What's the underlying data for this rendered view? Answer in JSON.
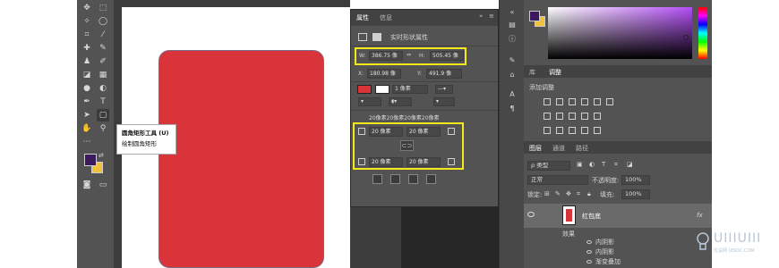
{
  "tooltip": {
    "title": "圆角矩形工具 (U)",
    "desc": "绘制圆角矩形"
  },
  "properties": {
    "tabs": [
      "属性",
      "信息"
    ],
    "header_label": "实时形状属性",
    "w_label": "W:",
    "w_value": "386.75 像",
    "h_label": "H:",
    "h_value": "505.45 像",
    "x_label": "X:",
    "x_value": "180.98 像",
    "y_label": "Y:",
    "y_value": "491.9 像",
    "stroke_width": "1 像素",
    "corner_summary": "20像素20像素20像素20像素",
    "corner_tl": "20 像素",
    "corner_tr": "20 像素",
    "corner_bl": "20 像素",
    "corner_br": "20 像素"
  },
  "colors": {
    "foreground": "#3a1a5c",
    "background": "#f0c23a",
    "shape_fill": "#d9343a",
    "highlight": "#f3e81a"
  },
  "right_panel": {
    "tabs": [
      "库",
      "调整"
    ],
    "adjust_title": "添加调整",
    "layer_tabs": [
      "图层",
      "通道",
      "路径"
    ],
    "filter_label": "ρ 类型",
    "blend_mode": "正常",
    "opacity_label": "不透明度:",
    "opacity_value": "100%",
    "lock_label": "锁定:",
    "fill_label": "填充:",
    "fill_value": "100%",
    "layer_name": "红包底",
    "fx_label": "fx",
    "effects_label": "效果",
    "effects": [
      "内阴影",
      "内阴影",
      "渐变叠加"
    ]
  },
  "watermark": {
    "brand": "UIIIUIII",
    "sub": "优设网 UISDC.COM"
  }
}
